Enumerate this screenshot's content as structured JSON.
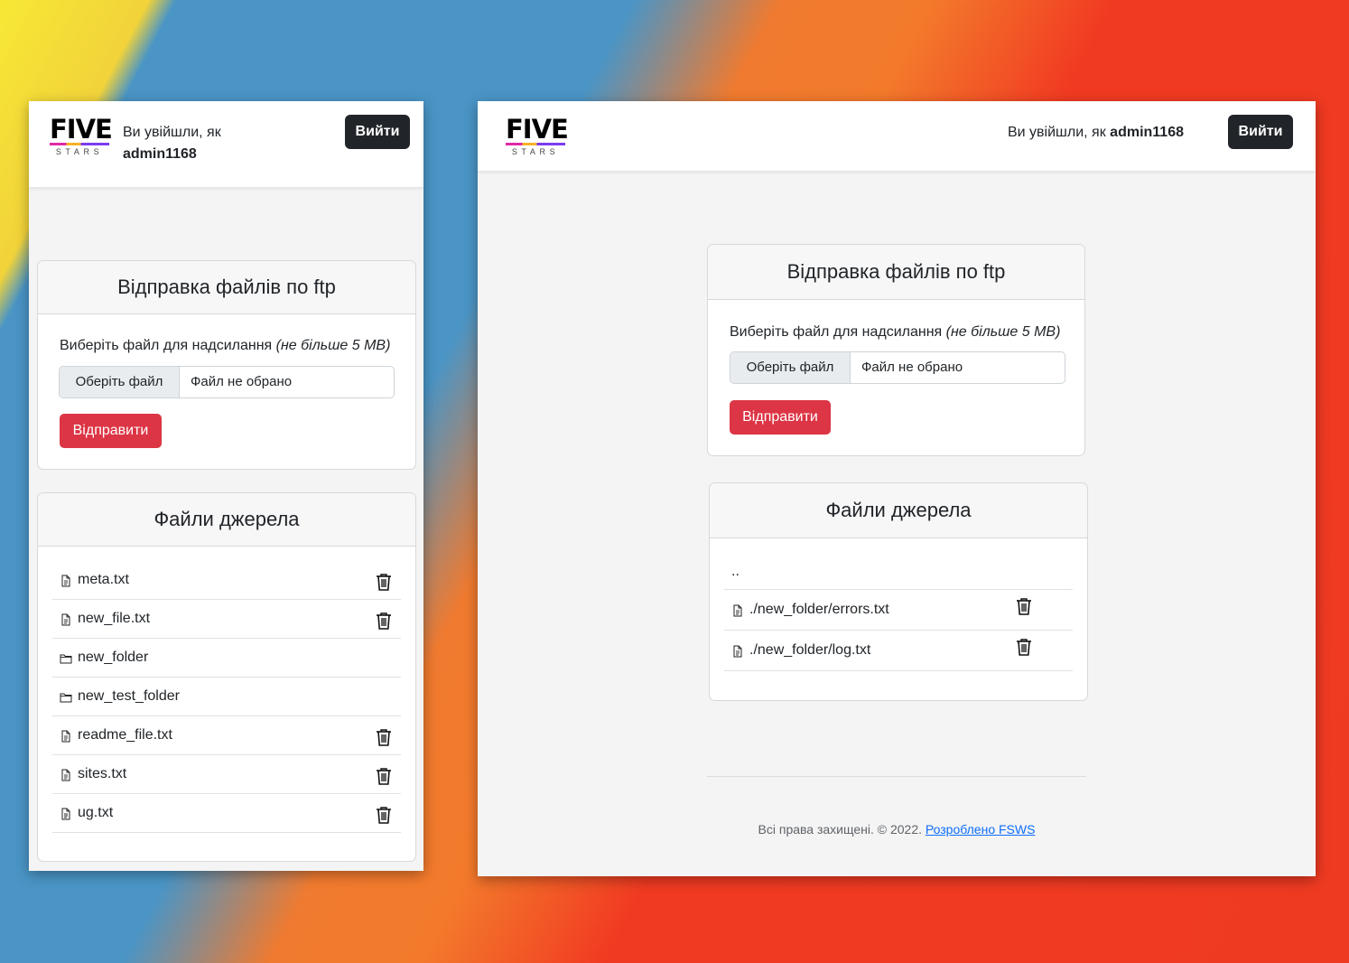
{
  "brand": {
    "logo_word": "FIVE",
    "logo_sub": "STARS"
  },
  "header": {
    "login_prefix": "Ви увійшли, як",
    "username": "admin1168",
    "logout_label": "Вийти"
  },
  "upload": {
    "title": "Відправка файлів по ftp",
    "label": "Виберіть файл для надсилання",
    "limit": "(не більше 5 MB)",
    "choose_label": "Оберіть файл",
    "no_file": "Файл не обрано",
    "submit_label": "Відправити"
  },
  "files_title": "Файли джерела",
  "left_files": [
    {
      "name": "meta.txt",
      "type": "file"
    },
    {
      "name": "new_file.txt",
      "type": "file"
    },
    {
      "name": "new_folder",
      "type": "folder"
    },
    {
      "name": "new_test_folder",
      "type": "folder"
    },
    {
      "name": "readme_file.txt",
      "type": "file"
    },
    {
      "name": "sites.txt",
      "type": "file"
    },
    {
      "name": "ug.txt",
      "type": "file"
    }
  ],
  "right_files": {
    "parent": "..",
    "items": [
      {
        "name": "./new_folder/errors.txt",
        "type": "file"
      },
      {
        "name": "./new_folder/log.txt",
        "type": "file"
      }
    ]
  },
  "footer": {
    "text": "Всі права захищені. © 2022.",
    "link": "Розроблено FSWS"
  },
  "colors": {
    "danger": "#dc3545",
    "dark": "#212529",
    "link": "#0d6efd"
  }
}
